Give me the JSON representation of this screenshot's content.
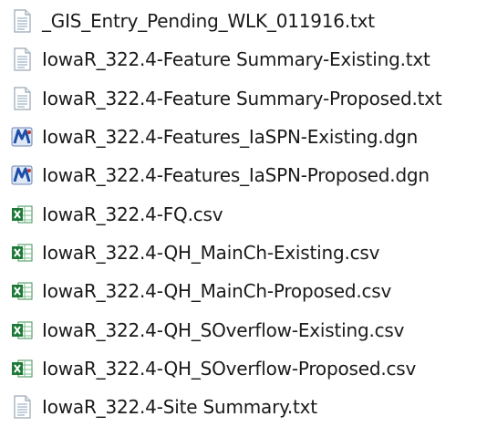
{
  "files": [
    {
      "name": "_GIS_Entry_Pending_WLK_011916.txt",
      "icon": "text-file-icon"
    },
    {
      "name": "IowaR_322.4-Feature Summary-Existing.txt",
      "icon": "text-file-icon"
    },
    {
      "name": "IowaR_322.4-Feature Summary-Proposed.txt",
      "icon": "text-file-icon"
    },
    {
      "name": "IowaR_322.4-Features_IaSPN-Existing.dgn",
      "icon": "dgn-file-icon"
    },
    {
      "name": "IowaR_322.4-Features_IaSPN-Proposed.dgn",
      "icon": "dgn-file-icon"
    },
    {
      "name": "IowaR_322.4-FQ.csv",
      "icon": "csv-file-icon"
    },
    {
      "name": "IowaR_322.4-QH_MainCh-Existing.csv",
      "icon": "csv-file-icon"
    },
    {
      "name": "IowaR_322.4-QH_MainCh-Proposed.csv",
      "icon": "csv-file-icon"
    },
    {
      "name": "IowaR_322.4-QH_SOverflow-Existing.csv",
      "icon": "csv-file-icon"
    },
    {
      "name": "IowaR_322.4-QH_SOverflow-Proposed.csv",
      "icon": "csv-file-icon"
    },
    {
      "name": "IowaR_322.4-Site Summary.txt",
      "icon": "text-file-icon"
    }
  ],
  "colors": {
    "csv_green": "#1f7a3a",
    "dgn_blue": "#1e4fa8",
    "txt_line": "#8aa0b8"
  }
}
